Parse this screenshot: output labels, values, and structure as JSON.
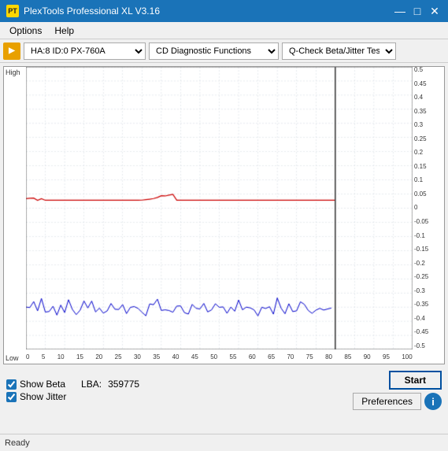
{
  "window": {
    "title": "PlexTools Professional XL V3.16",
    "icon": "PT"
  },
  "titlebar_controls": {
    "minimize": "—",
    "maximize": "□",
    "close": "✕"
  },
  "menu": {
    "items": [
      "Options",
      "Help"
    ]
  },
  "toolbar": {
    "drive": "HA:8 ID:0  PX-760A",
    "function": "CD Diagnostic Functions",
    "test": "Q-Check Beta/Jitter Test"
  },
  "chart": {
    "label_high": "High",
    "label_low": "Low",
    "y_labels": [
      "0.5",
      "0.45",
      "0.4",
      "0.35",
      "0.3",
      "0.25",
      "0.2",
      "0.15",
      "0.1",
      "0.05",
      "0",
      "-0.05",
      "-0.1",
      "-0.15",
      "-0.2",
      "-0.25",
      "-0.3",
      "-0.35",
      "-0.4",
      "-0.45",
      "-0.5"
    ],
    "x_labels": [
      "0",
      "5",
      "10",
      "15",
      "20",
      "25",
      "30",
      "35",
      "40",
      "45",
      "50",
      "55",
      "60",
      "65",
      "70",
      "75",
      "80",
      "85",
      "90",
      "95",
      "100"
    ]
  },
  "bottom": {
    "show_beta_label": "Show Beta",
    "show_jitter_label": "Show Jitter",
    "show_beta_checked": true,
    "show_jitter_checked": true,
    "lba_label": "LBA:",
    "lba_value": "359775",
    "start_button": "Start",
    "preferences_button": "Preferences",
    "info_icon": "i"
  },
  "status": {
    "text": "Ready"
  }
}
